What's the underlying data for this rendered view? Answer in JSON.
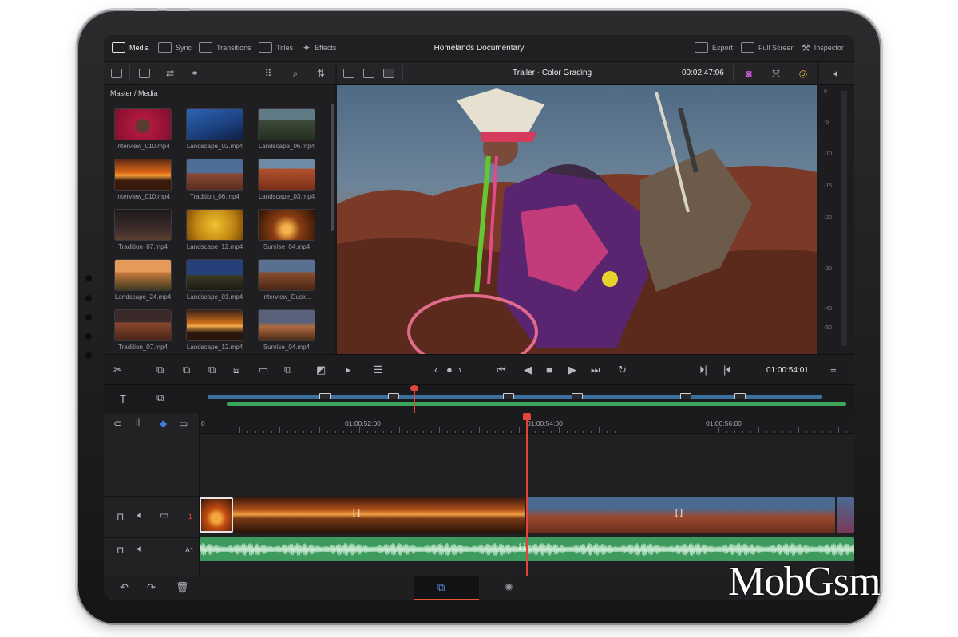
{
  "topbar": {
    "tabs": [
      {
        "label": "Media",
        "icon": "media-icon",
        "active": true
      },
      {
        "label": "Sync",
        "icon": "sync-icon"
      },
      {
        "label": "Transitions",
        "icon": "transitions-icon"
      },
      {
        "label": "Titles",
        "icon": "titles-icon"
      },
      {
        "label": "Effects",
        "icon": "effects-icon"
      }
    ],
    "project_title": "Homelands Documentary",
    "right": [
      {
        "label": "Export",
        "icon": "export-icon"
      },
      {
        "label": "Full Screen",
        "icon": "full-screen-icon"
      },
      {
        "label": "Inspector",
        "icon": "inspector-icon"
      }
    ]
  },
  "media_pool": {
    "breadcrumb": "Master / Media",
    "clips": [
      {
        "name": "Interview_010.mp4"
      },
      {
        "name": "Landscape_02.mp4"
      },
      {
        "name": "Landscape_06.mp4"
      },
      {
        "name": "Interview_010.mp4"
      },
      {
        "name": "Tradition_06.mp4"
      },
      {
        "name": "Landscape_03.mp4"
      },
      {
        "name": "Tradition_07.mp4"
      },
      {
        "name": "Landscape_12.mp4"
      },
      {
        "name": "Sunrise_04.mp4"
      },
      {
        "name": "Landscape_24.mp4"
      },
      {
        "name": "Landscape_01.mp4"
      },
      {
        "name": "Interview_Dusk..."
      },
      {
        "name": "Tradition_07.mp4"
      },
      {
        "name": "Landscape_12.mp4"
      },
      {
        "name": "Sunrise_04.mp4"
      }
    ]
  },
  "viewer": {
    "timeline_name": "Trailer - Color Grading",
    "timecode": "00:02:47:06"
  },
  "audio_meter": {
    "labels": [
      "0",
      "-5",
      "-10",
      "-15",
      "-20",
      "-30",
      "-40",
      "-50"
    ]
  },
  "transport": {
    "timecode": "01:00:54:01"
  },
  "timeline": {
    "ruler_labels": [
      "0",
      "01:00:52:00",
      "01:00:54:00",
      "01:00:56:00"
    ],
    "video_track_number": "1",
    "audio_track_label": "A1"
  },
  "colors": {
    "accent_playhead": "#e2463a",
    "audio_clip": "#3d9b5e",
    "overview_blue": "#3b6f9e",
    "active_page_underline": "#e45a2a"
  },
  "watermark": "MobGsm"
}
